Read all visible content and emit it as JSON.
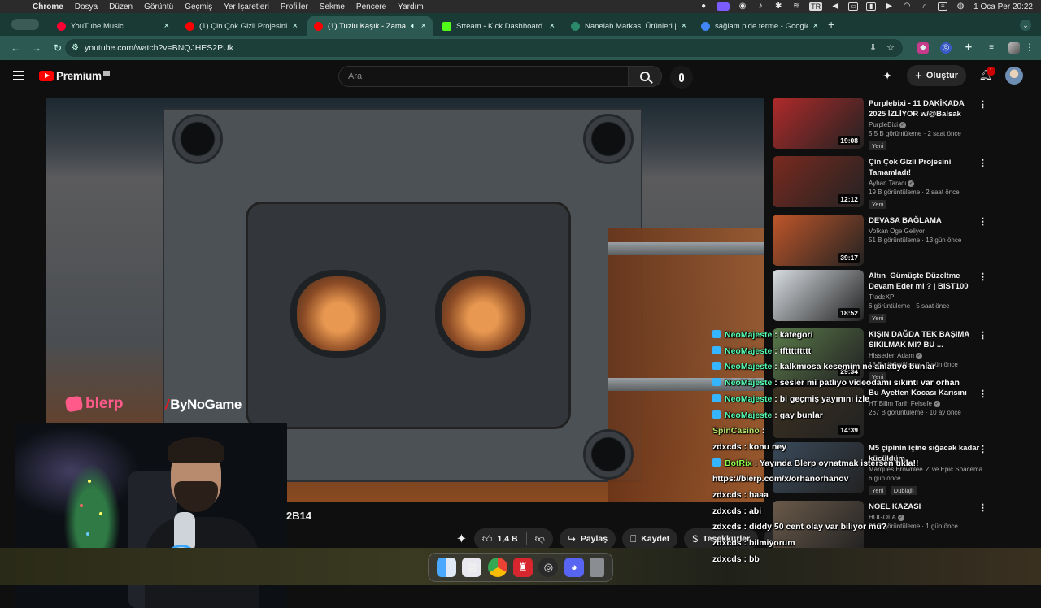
{
  "menubar": {
    "app": "Chrome",
    "items": [
      "Dosya",
      "Düzen",
      "Görüntü",
      "Geçmiş",
      "Yer İşaretleri",
      "Profiller",
      "Sekme",
      "Pencere",
      "Yardım"
    ],
    "keyboard": "TR",
    "clock": "1 Oca Per  20:22"
  },
  "tabs": [
    {
      "title": "YouTube Music",
      "favicon_color": "#ff0033"
    },
    {
      "title": "(1) Çin Çok Gizli Projesini Tam...",
      "favicon_color": "#ff0000"
    },
    {
      "title": "(1) Tuzlu Kaşık - Zamazing",
      "favicon_color": "#ff0000",
      "active": true
    },
    {
      "title": "Stream - Kick Dashboard",
      "favicon_color": "#53fc18"
    },
    {
      "title": "Nanelab Markası Ürünleri | R...",
      "favicon_color": "#2a8a6a"
    },
    {
      "title": "sağlam pide terme - Google'da...",
      "favicon_color": "#4285f4"
    }
  ],
  "address": {
    "url": "youtube.com/watch?v=BNQJHES2PUk"
  },
  "youtube": {
    "logo": "Premium",
    "search_placeholder": "Ara",
    "create_label": "Oluştur",
    "notif_count": "1"
  },
  "video": {
    "overlay_blerp": "blerp",
    "overlay_bynogame": "ByNoGame",
    "title_fragment": "2B14",
    "likes": "1,4 B",
    "share": "Paylaş",
    "save": "Kaydet",
    "thanks": "Teşekkürler",
    "more": "..."
  },
  "recommendations": [
    {
      "title": "Purplebixi - 11 DAKİKADA 2025 İZLİYOR w/@Balsak",
      "channel": "PurpleBixi",
      "verified": true,
      "views": "5,5 B görüntüleme",
      "age": "2 saat önce",
      "duration": "19:08",
      "new": "Yeni",
      "thumb": "#b02a2a"
    },
    {
      "title": "Çin Çok Gizli Projesini Tamamladı!",
      "channel": "Ayhan Taracı",
      "verified": true,
      "views": "19 B görüntüleme",
      "age": "2 saat önce",
      "duration": "12:12",
      "new": "Yeni",
      "thumb": "#7a2a20"
    },
    {
      "title": "DEVASA BAĞLAMA",
      "channel": "Volkan Öge Geliyor",
      "verified": false,
      "views": "51 B görüntüleme",
      "age": "13 gün önce",
      "duration": "39:17",
      "new": "",
      "thumb": "#c0562a"
    },
    {
      "title": "Altın–Gümüşte Düzeltme Devam Eder mi ? | BIST100 Gü...",
      "channel": "TradeXP",
      "verified": false,
      "views": "6 görüntüleme",
      "age": "5 saat önce",
      "duration": "18:52",
      "new": "Yeni",
      "thumb": "#d8dde2"
    },
    {
      "title": "KIŞIN DAĞDA TEK BAŞIMA SIKILMAK MI? BU ...",
      "channel": "Hisseden Adam",
      "verified": true,
      "views": "18 B görüntüleme",
      "age": "2 gün önce",
      "duration": "29:34",
      "new": "Yeni",
      "thumb": "#5a7a4a"
    },
    {
      "title": "Bu Ayetten Kocası Karısını",
      "channel": "HT Bilim Tarih Felsefe",
      "verified": true,
      "views": "267 B görüntüleme",
      "age": "10 ay önce",
      "duration": "14:39",
      "new": "",
      "thumb": "#3a3020"
    },
    {
      "title": "M5 çipinin içine sığacak kadar küçüldüm.",
      "channel": "Marques Brownlee ✓ ve Epic Spacema...",
      "verified": false,
      "views": "",
      "age": "6 gün önce",
      "duration": "",
      "new": "Yeni",
      "dubbed": "Dublajlı",
      "thumb": "#3a4a5a"
    },
    {
      "title": "NOEL KAZASI",
      "channel": "HUGOLA",
      "verified": true,
      "views": "30 B görüntüleme",
      "age": "1 gün önce",
      "duration": "",
      "new": "",
      "thumb": "#6a5a4a"
    }
  ],
  "chat": [
    {
      "user": "NeoMajeste",
      "msg": ": kategori",
      "kick": true,
      "ucls": "u-nm"
    },
    {
      "user": "NeoMajeste",
      "msg": ": tfttttttttt",
      "kick": true,
      "ucls": "u-nm"
    },
    {
      "user": "NeoMajeste",
      "msg": ": kalkmıosa kesemim ne anlatıyo bunlar",
      "kick": true,
      "ucls": "u-nm"
    },
    {
      "user": "NeoMajeste",
      "msg": ": sesler mi patlıyo videodamı sıkıntı var orhan",
      "kick": true,
      "ucls": "u-nm"
    },
    {
      "user": "NeoMajeste",
      "msg": ": bi geçmiş yayınını izle",
      "kick": true,
      "ucls": "u-nm"
    },
    {
      "user": "NeoMajeste",
      "msg": ": gay bunlar",
      "kick": true,
      "ucls": "u-nm"
    },
    {
      "user": "SpinCasino",
      "msg": ":",
      "kick": false,
      "ucls": "u-sc"
    },
    {
      "user": "zdxcds",
      "msg": ": konu ney",
      "kick": false,
      "ucls": ""
    },
    {
      "user": "BotRix",
      "msg": ": Yayında Blerp oynatmak istersen tıkla!!",
      "kick": true,
      "ucls": "u-br"
    },
    {
      "user": "",
      "msg": "https://blerp.com/x/orhanorhanov",
      "kick": false,
      "ucls": ""
    },
    {
      "user": "zdxcds",
      "msg": ": haaa",
      "kick": false,
      "ucls": ""
    },
    {
      "user": "zdxcds",
      "msg": ": abi",
      "kick": false,
      "ucls": ""
    },
    {
      "user": "zdxcds",
      "msg": ": diddy 50 cent olay var biliyor mu?",
      "kick": false,
      "ucls": ""
    },
    {
      "user": "zdxcds",
      "msg": ": bilmiyorum",
      "kick": false,
      "ucls": ""
    },
    {
      "user": "zdxcds",
      "msg": ": bb",
      "kick": false,
      "ucls": ""
    }
  ],
  "dock": [
    "finder-icon",
    "launchpad-icon",
    "chrome-icon",
    "app-red-icon",
    "obs-icon",
    "discord-icon",
    "trash-icon"
  ]
}
